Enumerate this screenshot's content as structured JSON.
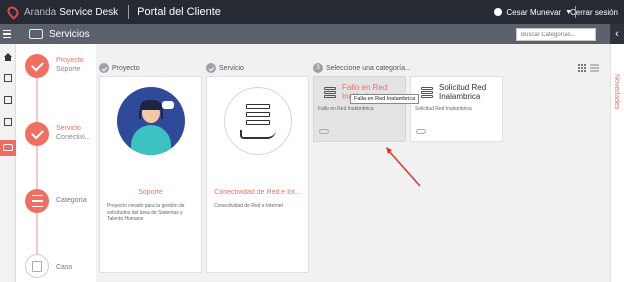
{
  "header": {
    "brand_prefix": "Aranda",
    "brand_name": "Service Desk",
    "portal": "Portal del Cliente",
    "user": "Cesar Munevar",
    "logout": "Cerrar sesión"
  },
  "subbar": {
    "title": "Servicios",
    "search_placeholder": "Buscar Categorías..."
  },
  "steps": [
    {
      "label": "Proyecto",
      "sub": "Soporte"
    },
    {
      "label": "Servicio",
      "sub": "Conectivi..."
    },
    {
      "label": "Categoría"
    },
    {
      "label": "Caso"
    }
  ],
  "columns": {
    "project": "Proyecto",
    "service": "Servicio",
    "category_num": "3",
    "category": "Seleccione una categoría..."
  },
  "project_card": {
    "title": "Soporte",
    "desc": "Proyecto creado para la gestión de solicitudes del área de Sistemas y Talento Humano"
  },
  "service_card": {
    "title": "Conectividad de Red e Int...",
    "desc": "Conectividad de Red e Internet"
  },
  "categories": [
    {
      "title": "Fallo en Red Inalámbrica",
      "desc": "Fallo en Red Inalámbrica"
    },
    {
      "title": "Solicitud Red Inalambrica",
      "desc": "Solicitud Red Inalambrica"
    }
  ],
  "tooltip": "Falla en Red Inalambrica",
  "rightbar": {
    "label": "Novedades"
  },
  "colors": {
    "accent": "#ef7060",
    "header": "#262a33",
    "subbar": "#5b616b"
  }
}
